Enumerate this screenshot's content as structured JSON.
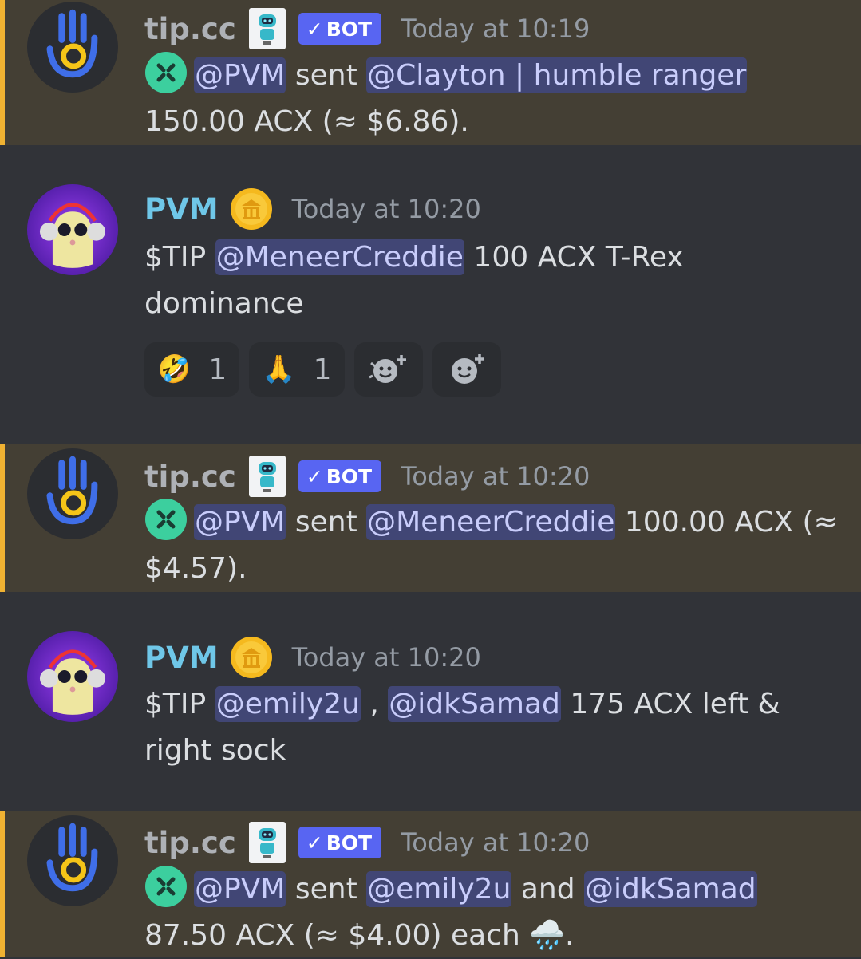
{
  "colors": {
    "background": "#313338",
    "highlight_background": "#443f34",
    "highlight_bar": "#f0b232",
    "mention_bg": "#414675",
    "mention_text": "#c9cdfb",
    "bot_tag": "#5865f2",
    "pvm_name": "#6fc7e8",
    "timestamp": "#949ba4"
  },
  "bot_tag": "BOT",
  "messages": [
    {
      "author": "tip.cc",
      "timestamp": "Today at 10:19",
      "mention_from": "@PVM",
      "sent_word": "sent",
      "mention_to": "@Clayton | humble ranger",
      "amount_line": "150.00 ACX (≈ $6.86)."
    },
    {
      "author": "PVM",
      "timestamp": "Today at 10:20",
      "cmd": "$TIP",
      "mention": "@MeneerCreddie",
      "rest": "100 ACX T-Rex dominance",
      "reactions": [
        {
          "emoji": "🤣",
          "icon": "rofl-emoji",
          "count": "1"
        },
        {
          "emoji": "🙏",
          "icon": "folded-hands-emoji",
          "count": "1"
        }
      ]
    },
    {
      "author": "tip.cc",
      "timestamp": "Today at 10:20",
      "mention_from": "@PVM",
      "sent_word": "sent",
      "mention_to": "@MeneerCreddie",
      "amount_line": "100.00 ACX (≈ $4.57)."
    },
    {
      "author": "PVM",
      "timestamp": "Today at 10:20",
      "cmd": "$TIP",
      "mention_1": "@emily2u",
      "separator": ",",
      "mention_2": "@idkSamad",
      "rest": "175 ACX left & right sock"
    },
    {
      "author": "tip.cc",
      "timestamp": "Today at 10:20",
      "mention_from": "@PVM",
      "sent_word": "sent",
      "mention_to_1": "@emily2u",
      "and_word": "and",
      "mention_to_2": "@idkSamad",
      "amount_line": "87.50 ACX (≈ $4.00) each",
      "trailing_emoji": "🌧️",
      "end": "."
    }
  ]
}
